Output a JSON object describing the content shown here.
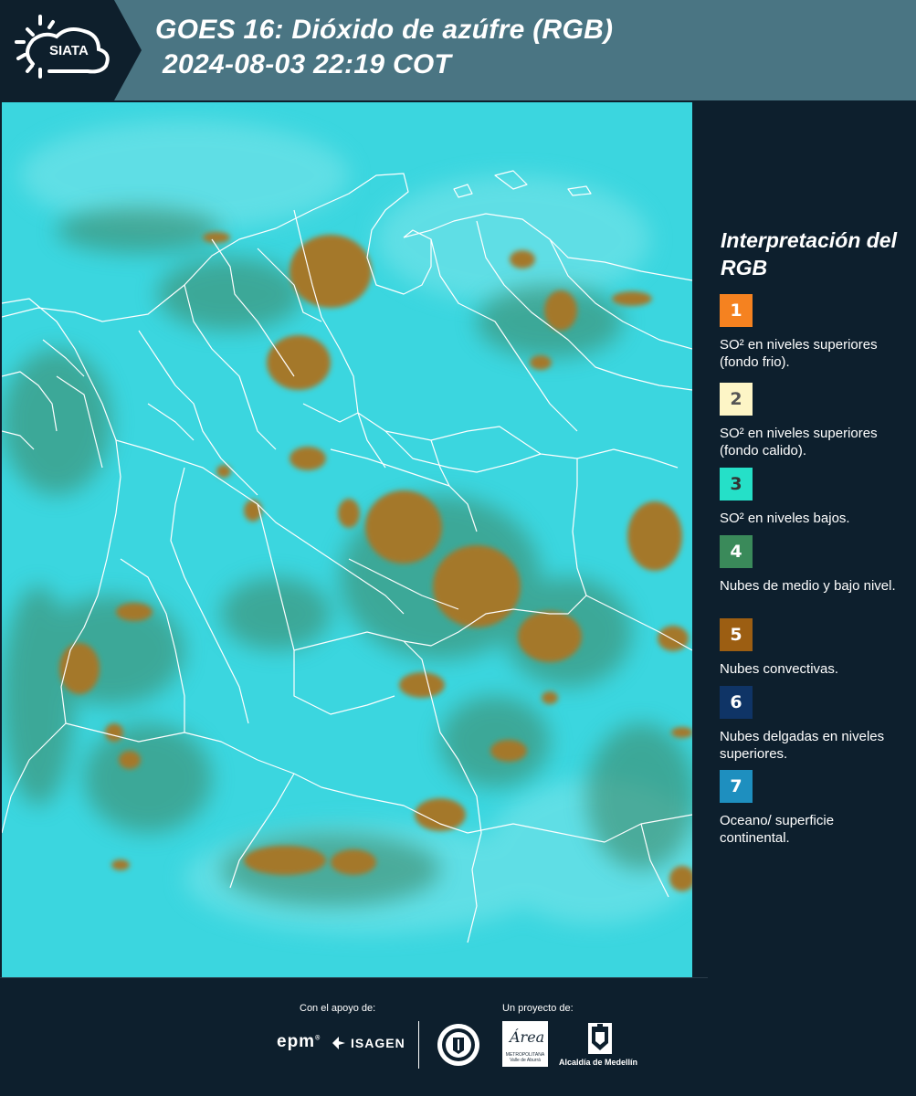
{
  "header": {
    "logo_text": "SIATA",
    "title_line1": "GOES 16: Dióxido de azúfre (RGB)",
    "title_line2": "2024-08-03 22:19 COT"
  },
  "legend": {
    "title": "Interpretación del RGB",
    "items": [
      {
        "number": "1",
        "color": "#f58220",
        "number_color": "#ffffff",
        "text": "SO² en niveles superiores (fondo frio)."
      },
      {
        "number": "2",
        "color": "#fdf5c6",
        "number_color": "#555555",
        "text": "SO² en niveles superiores (fondo calido)."
      },
      {
        "number": "3",
        "color": "#25e0c8",
        "number_color": "#333333",
        "text": "SO² en niveles bajos."
      },
      {
        "number": "4",
        "color": "#3a8a5a",
        "number_color": "#ffffff",
        "text": "Nubes de medio y bajo nivel."
      },
      {
        "number": "5",
        "color": "#9c5e12",
        "number_color": "#ffffff",
        "text": "Nubes convectivas."
      },
      {
        "number": "6",
        "color": "#0f3466",
        "number_color": "#ffffff",
        "text": "Nubes delgadas en niveles superiores."
      },
      {
        "number": "7",
        "color": "#1e8fbf",
        "number_color": "#ffffff",
        "text": "Oceano/ superficie continental."
      }
    ]
  },
  "footer": {
    "support_label": "Con el apoyo de:",
    "project_label": "Un proyecto de:",
    "sponsor_1": "epm",
    "sponsor_2": "ISAGEN",
    "area_logo_text": "Área",
    "area_logo_sub": "METROPOLITANA Valle de Aburrá",
    "alcaldia": "Alcaldía de Medellín"
  },
  "colors": {
    "header_bg": "#4a7583",
    "panel_bg": "#0d1f2d",
    "map_background": "#36d3dc",
    "cloud_convective": "#a4782a",
    "cloud_low_mid": "#3e8a6a",
    "boundaries": "#ffffff"
  }
}
